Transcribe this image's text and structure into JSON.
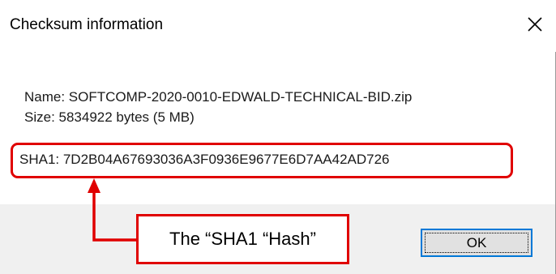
{
  "window": {
    "title": "Checksum information",
    "close_icon": "close-icon"
  },
  "file": {
    "name_line": "Name: SOFTCOMP-2020-0010-EDWALD-TECHNICAL-BID.zip",
    "size_line": "Size: 5834922 bytes (5 MB)"
  },
  "hash": {
    "sha1_line": "SHA1: 7D2B04A67693036A3F0936E9677E6D7AA42AD726"
  },
  "buttons": {
    "ok_label": "OK"
  },
  "annotation": {
    "callout_text": "The “SHA1 “Hash”",
    "color": "#e00000"
  },
  "colors": {
    "accent": "#0078d7",
    "footer_bg": "#f0f0f0"
  }
}
